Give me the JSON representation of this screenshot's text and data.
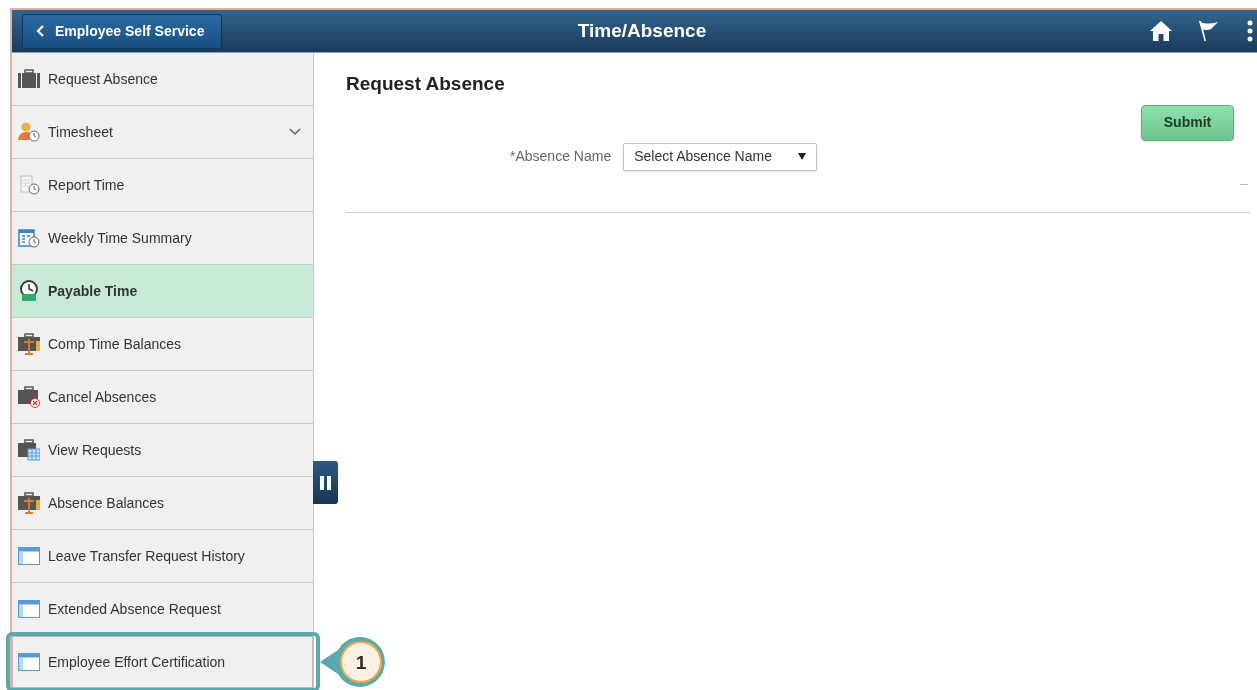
{
  "header": {
    "back_button": "Employee Self Service",
    "title": "Time/Absence"
  },
  "sidebar": {
    "items": [
      {
        "label": "Request Absence",
        "kind": "briefcase",
        "selected": false,
        "highlighted": false
      },
      {
        "label": "Timesheet",
        "kind": "person",
        "selected": false,
        "highlighted": false,
        "expanded": false
      },
      {
        "label": "Report Time",
        "kind": "document",
        "selected": false,
        "highlighted": false
      },
      {
        "label": "Weekly Time Summary",
        "kind": "calendar",
        "selected": false,
        "highlighted": false
      },
      {
        "label": "Payable Time",
        "kind": "clock",
        "selected": true,
        "highlighted": false
      },
      {
        "label": "Comp Time Balances",
        "kind": "scale",
        "selected": false,
        "highlighted": false
      },
      {
        "label": "Cancel Absences",
        "kind": "cancel",
        "selected": false,
        "highlighted": false
      },
      {
        "label": "View Requests",
        "kind": "grid",
        "selected": false,
        "highlighted": false
      },
      {
        "label": "Absence Balances",
        "kind": "scale",
        "selected": false,
        "highlighted": false
      },
      {
        "label": "Leave Transfer Request History",
        "kind": "window",
        "selected": false,
        "highlighted": false
      },
      {
        "label": "Extended Absence Request",
        "kind": "window",
        "selected": false,
        "highlighted": false
      },
      {
        "label": "Employee Effort Certification",
        "kind": "window",
        "selected": false,
        "highlighted": true
      }
    ]
  },
  "content": {
    "title": "Request Absence",
    "submit_button": "Submit",
    "absence_name": {
      "label": "*Absence Name",
      "value": "Select Absence Name"
    }
  },
  "callout": {
    "number": "1"
  }
}
